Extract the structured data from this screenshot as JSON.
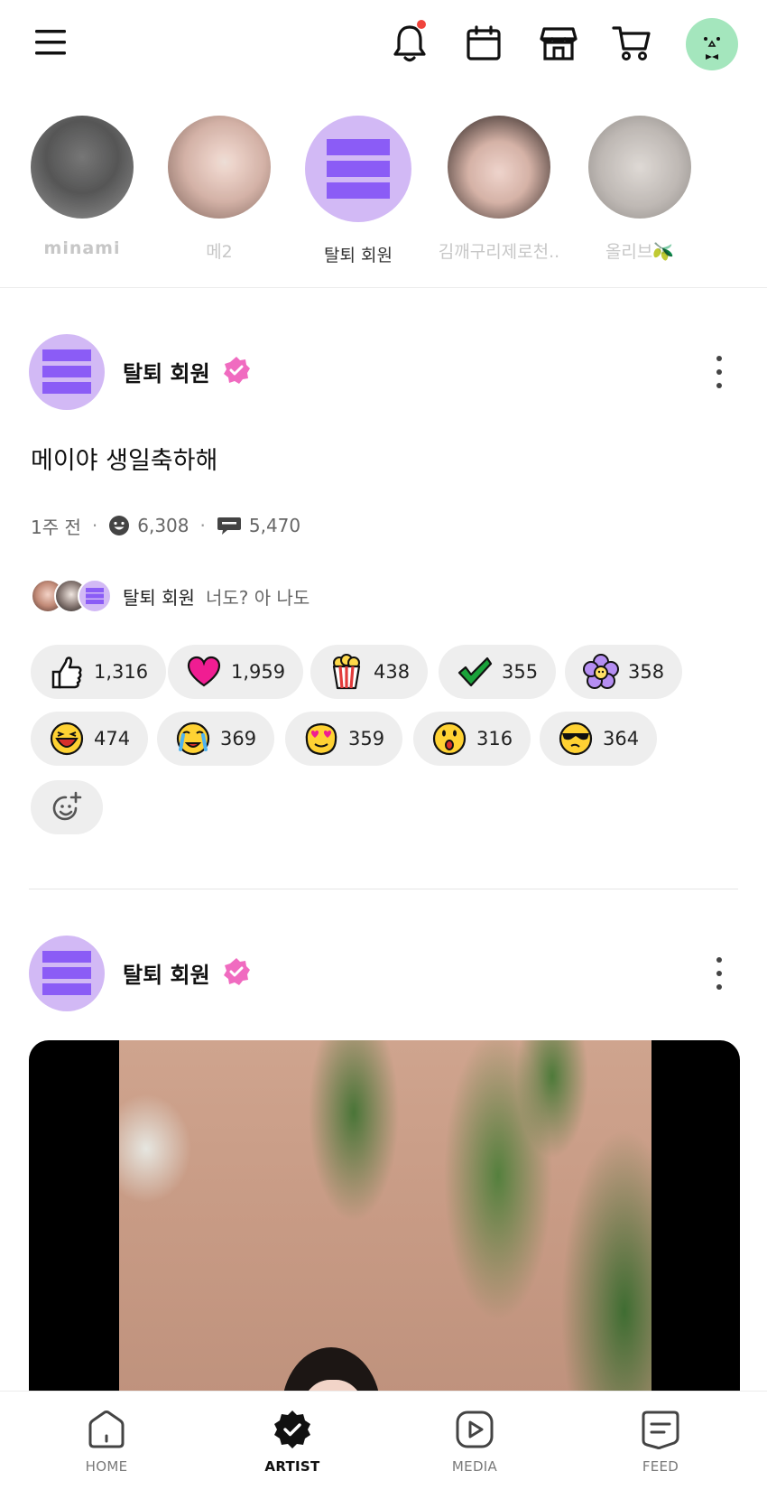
{
  "topbar": {
    "icons": [
      "menu-icon",
      "bell-icon",
      "calendar-icon",
      "shop-icon",
      "cart-icon",
      "profile-avatar"
    ],
    "notification_dot_color": "#f0443c"
  },
  "stories": [
    {
      "name": "minami"
    },
    {
      "name": "메2"
    },
    {
      "name": "탈퇴 회원"
    },
    {
      "name": "김깨구리제로천.."
    },
    {
      "name": "올리브🫒"
    }
  ],
  "posts": [
    {
      "author": "탈퇴 회원",
      "text": "메이야 생일축하해",
      "time": "1주 전",
      "likes": "6,308",
      "comments": "5,470",
      "friends_name": "탈퇴 회원",
      "friends_msg": "너도? 아 나도",
      "reactions": [
        {
          "emoji": "thumbs-up",
          "count": "1,316"
        },
        {
          "emoji": "heart",
          "count": "1,959"
        },
        {
          "emoji": "popcorn",
          "count": "438"
        },
        {
          "emoji": "check",
          "count": "355"
        },
        {
          "emoji": "flower",
          "count": "358"
        },
        {
          "emoji": "laughing-face",
          "count": "474"
        },
        {
          "emoji": "crying-face",
          "count": "369"
        },
        {
          "emoji": "heart-eyes-face",
          "count": "359"
        },
        {
          "emoji": "surprised-face",
          "count": "316"
        },
        {
          "emoji": "sunglasses-face",
          "count": "364"
        }
      ]
    },
    {
      "author": "탈퇴 회원"
    }
  ],
  "bottom_nav": [
    {
      "label": "HOME",
      "active": false
    },
    {
      "label": "ARTIST",
      "active": true
    },
    {
      "label": "MEDIA",
      "active": false
    },
    {
      "label": "FEED",
      "active": false
    }
  ],
  "colors": {
    "accent_purple": "#8b5cf6",
    "avatar_purple_bg": "#d2b9f5",
    "verified_pink": "#f06bc0",
    "profile_green": "#a4e6bd"
  }
}
